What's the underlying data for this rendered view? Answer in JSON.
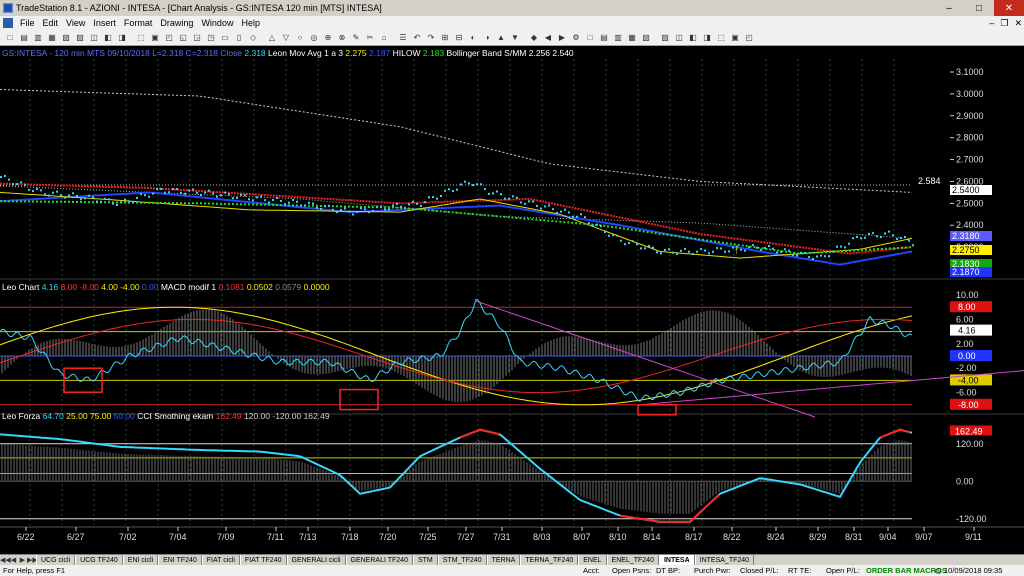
{
  "window": {
    "title": "TradeStation 8.1 - AZIONI - INTESA - [Chart Analysis - GS:INTESA  120 min  [MTS] INTESA]"
  },
  "menu": {
    "items": [
      "File",
      "Edit",
      "View",
      "Insert",
      "Format",
      "Drawing",
      "Window",
      "Help"
    ]
  },
  "price_pane": {
    "legend": [
      {
        "text": "GS:INTESA - 120 min   MTS   09/10/2018  L=2.318  C=2.318   Close",
        "color": "#5b6eff"
      },
      {
        "text": "2.318",
        "color": "#36d6ff"
      },
      {
        "text": "Leon Mov Avg 1 a 3",
        "color": "#ffffff"
      },
      {
        "text": "2.275",
        "color": "#ffee00"
      },
      {
        "text": "2.187",
        "color": "#3355ff"
      },
      {
        "text": "HILOW",
        "color": "#ffffff"
      },
      {
        "text": "2.183",
        "color": "#33dd33"
      },
      {
        "text": "Bollinger Band S/MM",
        "color": "#ffffff"
      },
      {
        "text": "2.256",
        "color": "#ffffff"
      },
      {
        "text": "2.540",
        "color": "#ffffff"
      }
    ],
    "axis_ticks": [
      "3.1000",
      "3.0000",
      "2.9000",
      "2.8000",
      "2.7000",
      "2.6000",
      "2.5000",
      "2.4000",
      "2.3000",
      "2.2000"
    ],
    "marker_label": "2.584",
    "badges": [
      {
        "text": "2.5400",
        "bg": "#ffffff",
        "fg": "#000000"
      },
      {
        "text": "2.3180",
        "bg": "#5a5aff",
        "fg": "#ffffff"
      },
      {
        "text": "2.2750",
        "bg": "#ffee00",
        "fg": "#000000"
      },
      {
        "text": "2.1830",
        "bg": "#11aa11",
        "fg": "#ffffff"
      },
      {
        "text": "2.1870",
        "bg": "#2233ff",
        "fg": "#ffffff"
      }
    ]
  },
  "macd_pane": {
    "legend": [
      {
        "text": "Leo Chart",
        "color": "#ffffff"
      },
      {
        "text": "4.16",
        "color": "#36d6ff"
      },
      {
        "text": "8.00",
        "color": "#ff3333"
      },
      {
        "text": "-8.00",
        "color": "#ff3333"
      },
      {
        "text": "4.00",
        "color": "#ffee00"
      },
      {
        "text": "-4.00",
        "color": "#ffee00"
      },
      {
        "text": "0.00",
        "color": "#3355ff"
      },
      {
        "text": "MACD modif 1",
        "color": "#ffffff"
      },
      {
        "text": "0.1081",
        "color": "#ff3333"
      },
      {
        "text": "0.0502",
        "color": "#ffee00"
      },
      {
        "text": "0.0579",
        "color": "#888888"
      },
      {
        "text": "0.0000",
        "color": "#ffee00"
      }
    ],
    "axis_ticks": [
      "10.00",
      "6.00",
      "2.00",
      "-2.00",
      "-6.00"
    ],
    "badges": [
      {
        "text": "8.00",
        "bg": "#dd1111",
        "fg": "#ffffff"
      },
      {
        "text": "4.16",
        "bg": "#ffffff",
        "fg": "#000000"
      },
      {
        "text": "0.00",
        "bg": "#2233ff",
        "fg": "#ffffff"
      },
      {
        "text": "-4.00",
        "bg": "#ddcc00",
        "fg": "#000000"
      },
      {
        "text": "-8.00",
        "bg": "#dd1111",
        "fg": "#ffffff"
      }
    ]
  },
  "cci_pane": {
    "legend": [
      {
        "text": "Leo Forza",
        "color": "#ffffff"
      },
      {
        "text": "64.70",
        "color": "#36d6ff"
      },
      {
        "text": "25.00",
        "color": "#ffee00"
      },
      {
        "text": "75.00",
        "color": "#ffee00"
      },
      {
        "text": "50.00",
        "color": "#3355ff"
      },
      {
        "text": "CCI Smothing ekam",
        "color": "#ffffff"
      },
      {
        "text": "162.49",
        "color": "#ff3333"
      },
      {
        "text": "120.00",
        "color": "#cccccc"
      },
      {
        "text": "-120.00",
        "color": "#cccccc"
      },
      {
        "text": "162.49",
        "color": "#cccccc"
      }
    ],
    "axis_ticks": [
      "120.00",
      "0.00",
      "-120.00"
    ],
    "badges": [
      {
        "text": "162.49",
        "bg": "#dd1111",
        "fg": "#ffffff"
      }
    ]
  },
  "time_axis": [
    "6/22",
    "6/27",
    "7/02",
    "7/04",
    "7/09",
    "7/11",
    "7/13",
    "7/18",
    "7/20",
    "7/25",
    "7/27",
    "7/31",
    "8/03",
    "8/07",
    "8/10",
    "8/14",
    "8/17",
    "8/22",
    "8/24",
    "8/29",
    "8/31",
    "9/04",
    "9/07",
    "9/11"
  ],
  "tabs": [
    "UCG cicli",
    "UCG TF240",
    "ENI cicli",
    "ENI TF240",
    "FIAT cicli",
    "FIAT TF240",
    "GENERALI cicli",
    "GENERALI TF240",
    "STM",
    "STM_TF240",
    "TERNA",
    "TERNA_TF240",
    "ENEL",
    "ENEL_TF240",
    "INTESA",
    "INTESA_TF240"
  ],
  "active_tab": "INTESA",
  "status": {
    "help": "For Help, press F1",
    "acct": "Acct:",
    "open_psns": "Open Psns:",
    "dt_bp": "DT BP:",
    "purch_pwr": "Purch Pwr:",
    "closed_pl": "Closed P/L:",
    "rt_te": "RT TE:",
    "open_pl": "Open P/L:",
    "order_bar": "ORDER BAR  MACROS",
    "datetime": "10/09/2018 09:35"
  }
}
